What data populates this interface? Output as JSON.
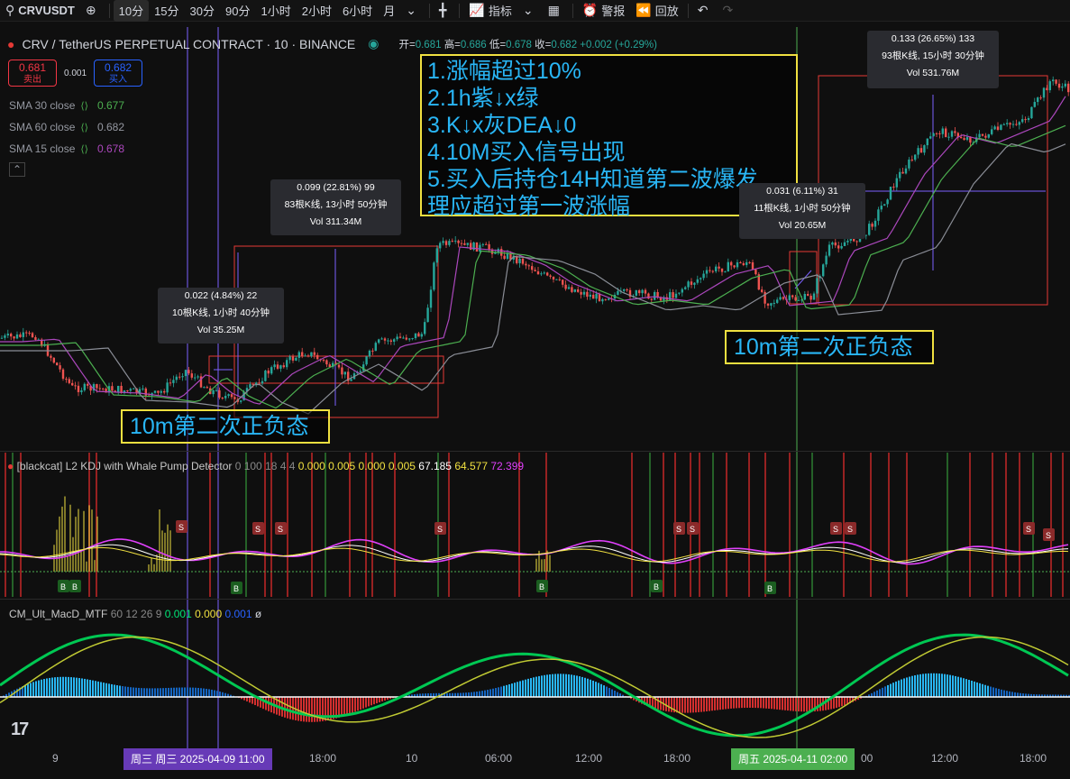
{
  "toolbar": {
    "symbol": "CRVUSDT",
    "intervals": [
      "10分",
      "15分",
      "30分",
      "90分",
      "1小时",
      "2小时",
      "6小时",
      "月"
    ],
    "active_interval": "10分",
    "indicators_label": "指标",
    "alert_label": "警报",
    "replay_label": "回放"
  },
  "header": {
    "title": "CRV / TetherUS PERPETUAL CONTRACT · 10 · BINANCE",
    "ohlc_open_label": "开=",
    "ohlc_open": "0.681",
    "ohlc_high_label": "高=",
    "ohlc_high": "0.686",
    "ohlc_low_label": "低=",
    "ohlc_low": "0.678",
    "ohlc_close_label": "收=",
    "ohlc_close": "0.682",
    "change": "+0.002 (+0.29%)"
  },
  "trade": {
    "sell_price": "0.681",
    "sell_label": "卖出",
    "spread": "0.001",
    "buy_price": "0.682",
    "buy_label": "买入"
  },
  "sma": [
    {
      "label": "SMA 30 close",
      "value": "0.677",
      "color": "#4caf50"
    },
    {
      "label": "SMA 60 close",
      "value": "0.682",
      "color": "#9598a1"
    },
    {
      "label": "SMA 15 close",
      "value": "0.678",
      "color": "#ab47bc"
    }
  ],
  "notes": [
    "1.涨幅超过10%",
    "2.1h紫↓x绿",
    "3.K↓x灰DEA↓0",
    "4.10M买入信号出现",
    "5.买入后持仓14H知道第二波爆发",
    "理应超过第一波涨幅"
  ],
  "tags": {
    "first": "10m第二次正负态",
    "second": "10m第二次正负态"
  },
  "measures": [
    {
      "line1": "0.022 (4.84%) 22",
      "line2": "10根K线, 1小时 40分钟",
      "line3": "Vol 35.25M"
    },
    {
      "line1": "0.099 (22.81%) 99",
      "line2": "83根K线, 13小时 50分钟",
      "line3": "Vol 311.34M"
    },
    {
      "line1": "0.031 (6.11%) 31",
      "line2": "11根K线, 1小时 50分钟",
      "line3": "Vol 20.65M"
    },
    {
      "line1": "0.133 (26.65%) 133",
      "line2": "93根K线, 15小时 30分钟",
      "line3": "Vol 531.76M"
    }
  ],
  "kdj": {
    "title": "[blackcat] L2 KDJ with Whale Pump Detector",
    "params": "0 100 18 4 4",
    "values": [
      "0.000",
      "0.005",
      "0.000",
      "0.005"
    ],
    "k": "67.185",
    "d": "64.577",
    "j": "72.399",
    "s_label": "S",
    "b_label": "B"
  },
  "macd": {
    "title": "CM_Ult_MacD_MTF",
    "params": "60 12 26 9",
    "v1": "0.001",
    "v2": "0.000",
    "v3": "0.001",
    "v4": "ø"
  },
  "xaxis": {
    "ticks": [
      "9",
      "18:00",
      "10",
      "06:00",
      "12:00",
      "18:00",
      "12:00",
      "18:00"
    ],
    "pill1": "周三  周三 2025-04-09   11:00",
    "pill2": "周五  2025-04-11   02:00",
    "hidden_tick": "00"
  },
  "colors": {
    "up": "#26a69a",
    "down": "#ef5350",
    "purple_line": "#7b61ff",
    "green_line": "#4caf50"
  }
}
